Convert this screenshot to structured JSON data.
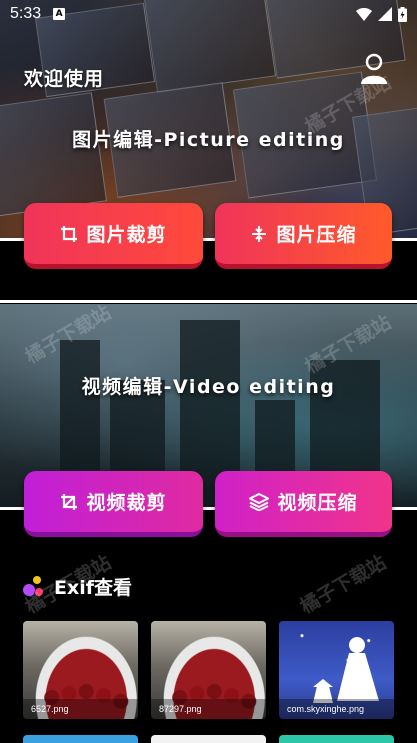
{
  "status_bar": {
    "time": "5:33",
    "notification_glyph": "A",
    "icons": [
      "wifi-icon",
      "signal-icon",
      "battery-icon"
    ]
  },
  "header": {
    "welcome": "欢迎使用",
    "user_icon": "user-profile-icon"
  },
  "picture_section": {
    "title": "图片编辑-Picture editing",
    "buttons": [
      {
        "label": "图片裁剪",
        "icon": "crop-icon"
      },
      {
        "label": "图片压缩",
        "icon": "compress-icon"
      }
    ]
  },
  "video_section": {
    "title": "视频编辑-Video editing",
    "buttons": [
      {
        "label": "视频裁剪",
        "icon": "crop-icon"
      },
      {
        "label": "视频压缩",
        "icon": "layers-icon"
      }
    ]
  },
  "exif": {
    "title": "Exif查看",
    "icon": "dots-icon",
    "thumbnails": [
      {
        "caption": "6527.png"
      },
      {
        "caption": "87297.png"
      },
      {
        "caption": "com.skyxinghe.png"
      }
    ]
  },
  "watermark": "橘子下载站",
  "colors": {
    "red_button": "#f0345a",
    "orange_button": "#ff4a3a",
    "purple_button": "#c01fd8",
    "magenta_button": "#f0348a"
  }
}
